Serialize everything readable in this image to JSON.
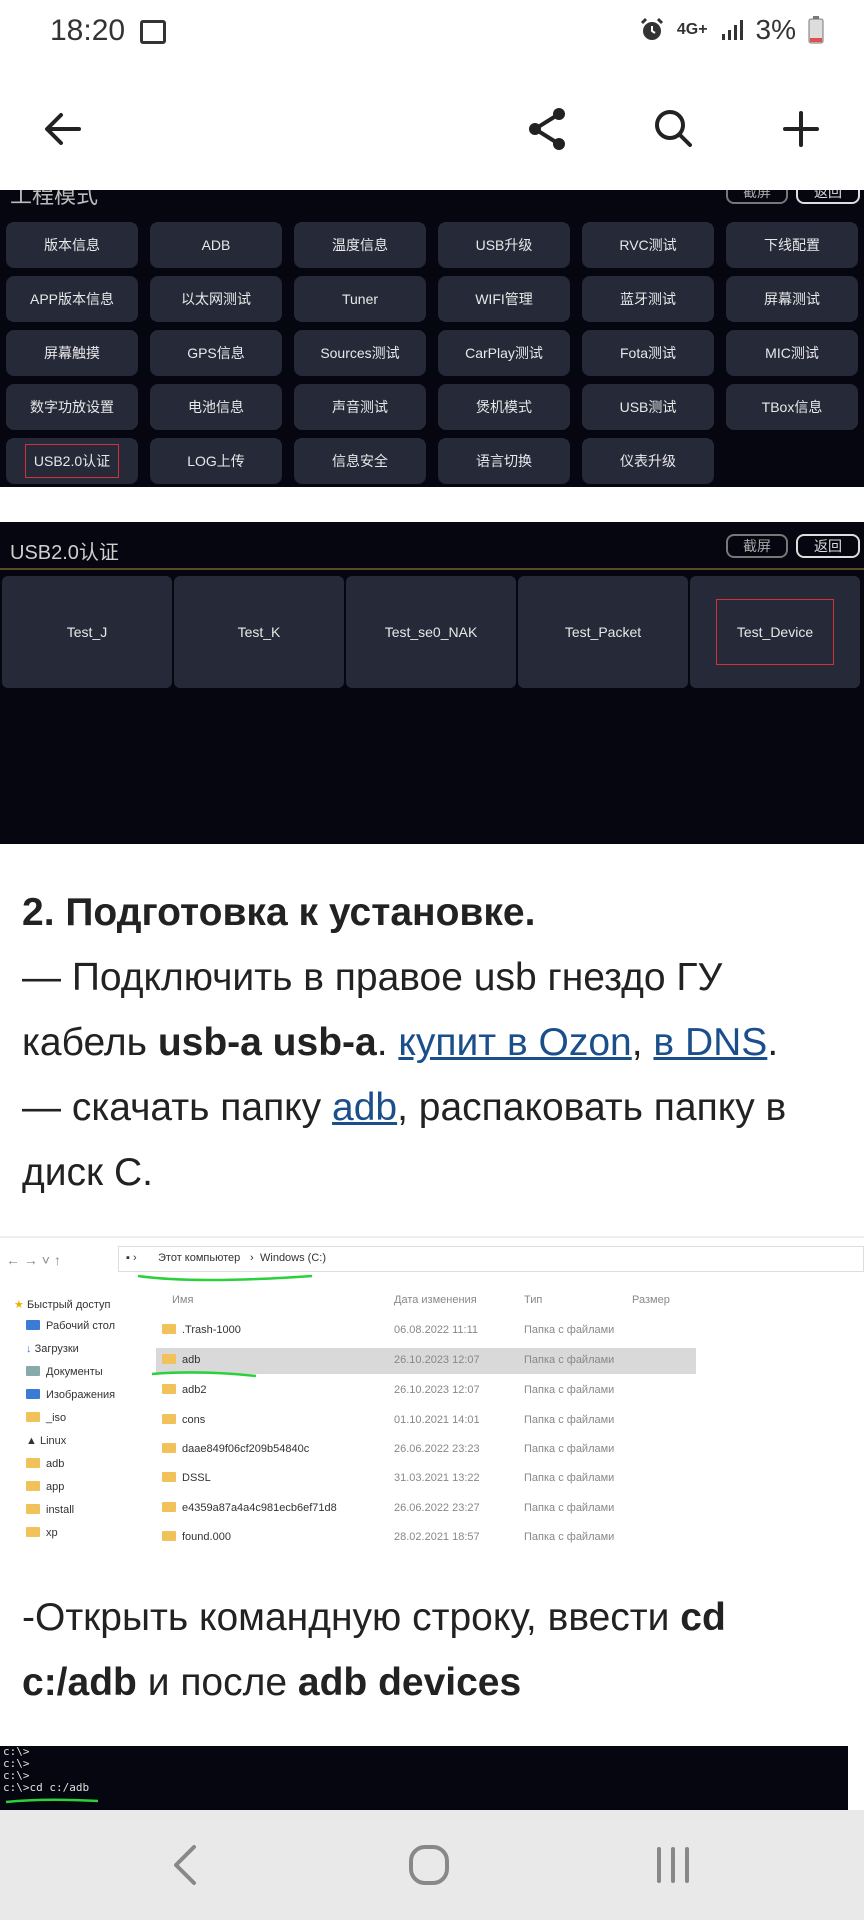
{
  "status_bar": {
    "time": "18:20",
    "network": "4G+",
    "battery": "3%",
    "icons": [
      "image-icon",
      "alarm-icon",
      "signal-icon",
      "battery-icon"
    ]
  },
  "toolbar": {
    "icons": [
      "back-arrow-icon",
      "share-icon",
      "search-icon",
      "plus-icon"
    ]
  },
  "shot1": {
    "title": "工程模式",
    "header_buttons": [
      "截屏",
      "返回"
    ],
    "grid": [
      [
        "版本信息",
        "ADB",
        "温度信息",
        "USB升级",
        "RVC测试",
        "下线配置"
      ],
      [
        "APP版本信息",
        "以太网测试",
        "Tuner",
        "WIFI管理",
        "蓝牙测试",
        "屏幕测试"
      ],
      [
        "屏幕触摸",
        "GPS信息",
        "Sources测试",
        "CarPlay测试",
        "Fota测试",
        "MIC测试"
      ],
      [
        "数字功放设置",
        "电池信息",
        "声音测试",
        "煲机模式",
        "USB测试",
        "TBox信息"
      ],
      [
        "USB2.0认证",
        "LOG上传",
        "信息安全",
        "语言切换",
        "仪表升级"
      ]
    ]
  },
  "shot2": {
    "title": "USB2.0认证",
    "header_buttons": [
      "截屏",
      "返回"
    ],
    "tests": [
      "Test_J",
      "Test_K",
      "Test_se0_NAK",
      "Test_Packet",
      "Test_Device"
    ]
  },
  "article": {
    "heading": "2. Подготовка к установке.",
    "line1_a": "— Подключить в правое usb гнездо ГУ кабель ",
    "line1_bold": "usb-a usb-a",
    "line1_b": ". ",
    "link1": "купит в Ozon",
    "comma": ", ",
    "link2": "в DNS",
    "dot": ".",
    "line2_a": "— скачать папку ",
    "link3": "adb",
    "line2_b": ", распаковать папку в диск С.",
    "p2_a": "-Открыть командную строку, ввести ",
    "p2_bold1": "cd c:/adb",
    "p2_b": " и после ",
    "p2_bold2": "adb devices"
  },
  "explorer": {
    "path": [
      "Этот компьютер",
      "Windows (C:)"
    ],
    "columns": [
      "Имя",
      "Дата изменения",
      "Тип",
      "Размер"
    ],
    "sidebar": [
      "Быстрый доступ",
      "Рабочий стол",
      "Загрузки",
      "Документы",
      "Изображения",
      "_iso",
      "Linux",
      "adb",
      "app",
      "install",
      "xp"
    ],
    "rows": [
      {
        "name": ".Trash-1000",
        "date": "06.08.2022 11:11",
        "type": "Папка с файлами"
      },
      {
        "name": "adb",
        "date": "26.10.2023 12:07",
        "type": "Папка с файлами"
      },
      {
        "name": "adb2",
        "date": "26.10.2023 12:07",
        "type": "Папка с файлами"
      },
      {
        "name": "cons",
        "date": "01.10.2021 14:01",
        "type": "Папка с файлами"
      },
      {
        "name": "daae849f06cf209b54840c",
        "date": "26.06.2022 23:23",
        "type": "Папка с файлами"
      },
      {
        "name": "DSSL",
        "date": "31.03.2021 13:22",
        "type": "Папка с файлами"
      },
      {
        "name": "e4359a87a4a4c981ecb6ef71d8",
        "date": "26.06.2022 23:27",
        "type": "Папка с файлами"
      },
      {
        "name": "found.000",
        "date": "28.02.2021 18:57",
        "type": "Папка с файлами"
      }
    ]
  },
  "terminal": {
    "lines": [
      "c:\\>",
      "c:\\>",
      "c:\\>",
      "c:\\>cd c:/adb"
    ]
  },
  "navbar": {
    "icons": [
      "nav-back-icon",
      "nav-home-icon",
      "nav-recents-icon"
    ]
  }
}
